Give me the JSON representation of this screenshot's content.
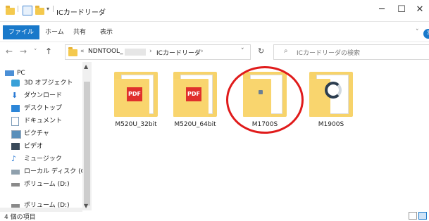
{
  "window": {
    "title": "ICカードリーダ",
    "controls": {
      "minimize": "─",
      "maximize": "☐",
      "close": "✕"
    }
  },
  "ribbon": {
    "tabs": [
      "ファイル",
      "ホーム",
      "共有",
      "表示"
    ],
    "expand": "˅",
    "help": "?"
  },
  "nav": {
    "back": "←",
    "forward": "→",
    "recent": "˅",
    "up": "↑",
    "address_prefix": "«",
    "crumbs": [
      "NDNTOOL_",
      "ICカードリーダ"
    ],
    "separator": "›",
    "address_dropdown": "˅",
    "refresh": "↻",
    "search_icon": "⌕",
    "search_placeholder": "ICカードリーダの検索"
  },
  "navpane": {
    "items": [
      "PC",
      "3D オブジェクト",
      "ダウンロード",
      "デスクトップ",
      "ドキュメント",
      "ピクチャ",
      "ビデオ",
      "ミュージック",
      "ローカル ディスク (C",
      "ボリューム (D:)",
      "ボリューム (D:)"
    ]
  },
  "files": [
    {
      "name": "M520U_32bit",
      "badge": "PDF"
    },
    {
      "name": "M520U_64bit",
      "badge": "PDF"
    },
    {
      "name": "M1700S",
      "badge": ""
    },
    {
      "name": "M1900S",
      "badge": ""
    }
  ],
  "status": {
    "count": "4 個の項目"
  },
  "colors": {
    "accent": "#1979ca",
    "folder": "#f7d36a",
    "highlight_ring": "#e01b1b"
  }
}
